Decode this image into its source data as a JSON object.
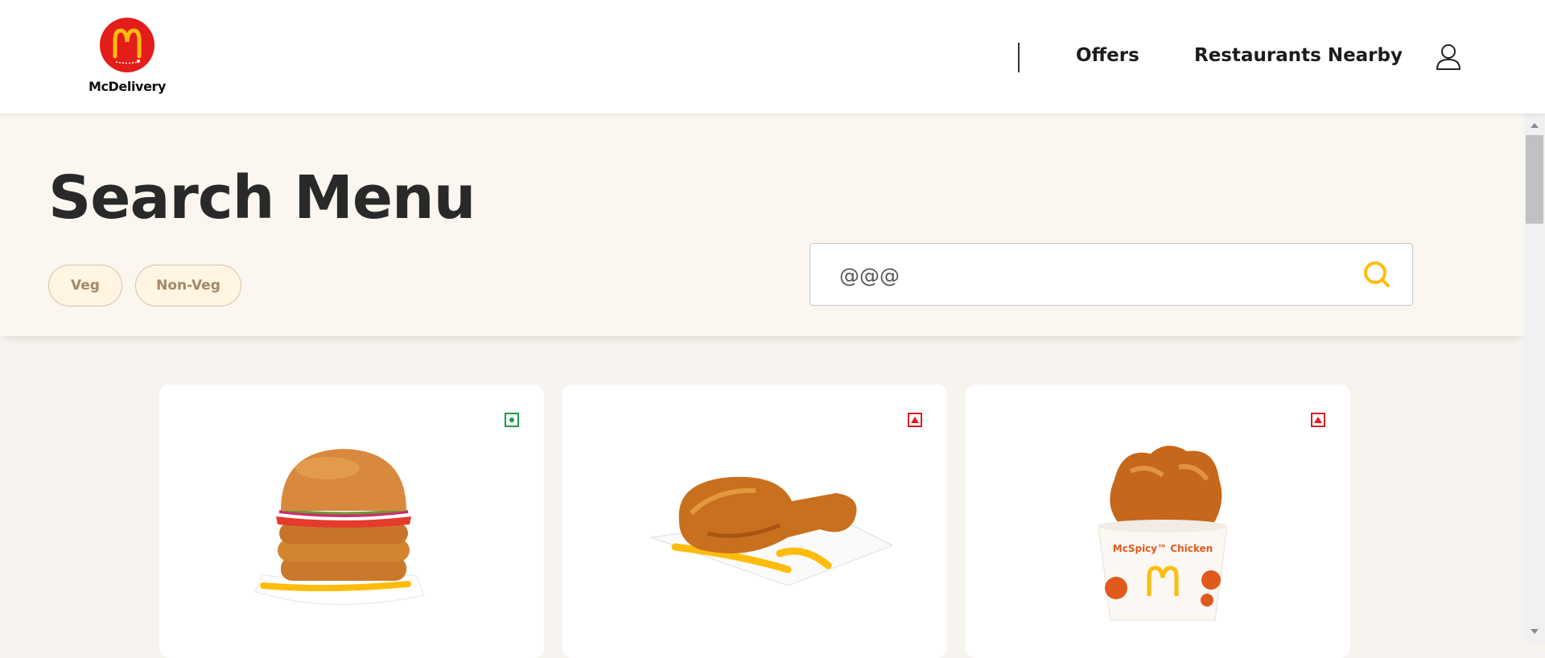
{
  "header": {
    "brand_name": "McDelivery",
    "logo_icon": "golden-arches-icon",
    "nav": [
      {
        "label": "Offers"
      },
      {
        "label": "Restaurants Nearby"
      }
    ],
    "user_icon": "user-icon"
  },
  "hero": {
    "title": "Search Menu",
    "filters": [
      {
        "label": "Veg"
      },
      {
        "label": "Non-Veg"
      }
    ],
    "search": {
      "value": "@@@",
      "icon": "search-icon"
    }
  },
  "products": [
    {
      "diet": "veg",
      "image": "burger-image"
    },
    {
      "diet": "non-veg",
      "image": "fried-chicken-leg-image"
    },
    {
      "diet": "non-veg",
      "image": "chicken-bucket-image",
      "bucket_text": "McSpicy™ Chicken"
    }
  ],
  "colors": {
    "brand_red": "#e31d1a",
    "brand_yellow": "#ffbc0d",
    "veg_green": "#1e9c4e",
    "nonveg_red": "#e01b24",
    "background": "#f7f3ee"
  }
}
